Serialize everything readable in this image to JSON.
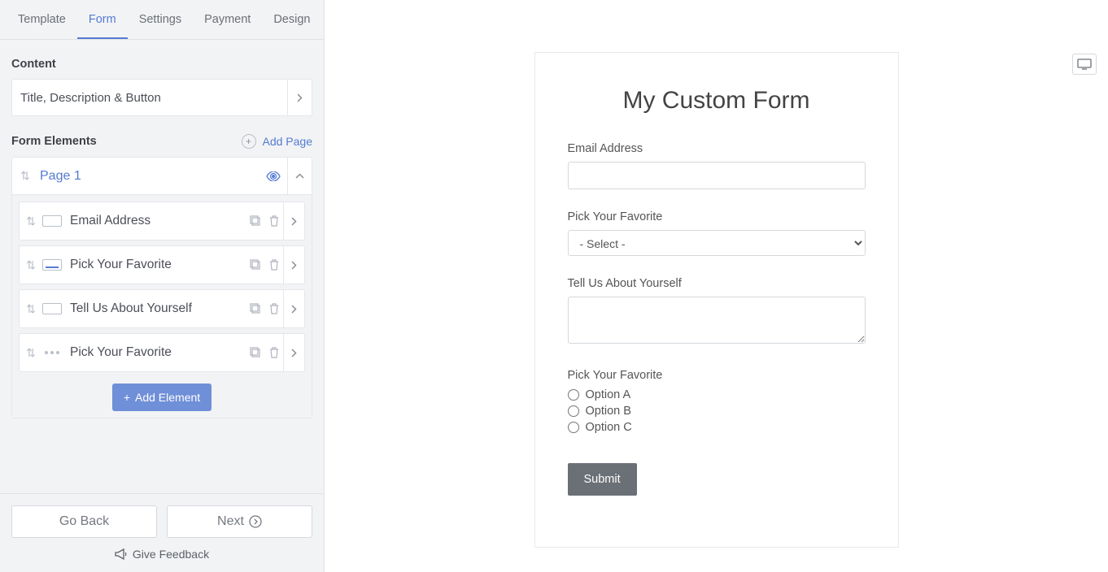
{
  "tabs": {
    "template": "Template",
    "form": "Form",
    "settings": "Settings",
    "payment": "Payment",
    "design": "Design"
  },
  "sidebar": {
    "content_section": "Content",
    "content_item": "Title, Description & Button",
    "form_elements_section": "Form Elements",
    "add_page": "Add Page",
    "page_label": "Page 1",
    "elements": [
      {
        "label": "Email Address",
        "icon": "text"
      },
      {
        "label": "Pick Your Favorite",
        "icon": "select"
      },
      {
        "label": "Tell Us About Yourself",
        "icon": "textarea"
      },
      {
        "label": "Pick Your Favorite",
        "icon": "radio"
      }
    ],
    "add_element": "Add Element"
  },
  "footer": {
    "back": "Go Back",
    "next": "Next",
    "feedback": "Give Feedback"
  },
  "preview": {
    "title": "My Custom Form",
    "fields": {
      "email_label": "Email Address",
      "select_label": "Pick Your Favorite",
      "select_placeholder": "- Select -",
      "textarea_label": "Tell Us About Yourself",
      "radio_label": "Pick Your Favorite",
      "radio_options": [
        "Option A",
        "Option B",
        "Option C"
      ]
    },
    "submit": "Submit"
  }
}
